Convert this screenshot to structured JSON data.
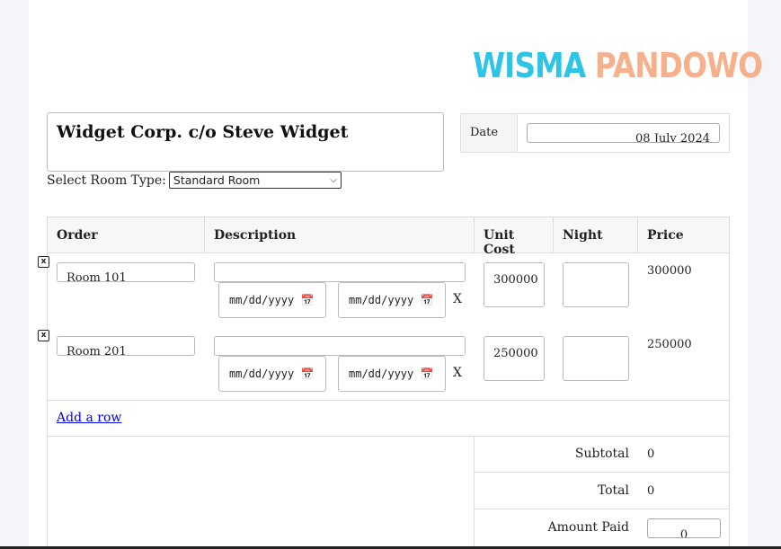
{
  "logo": {
    "word1": "WISMA",
    "word2": "PANDOWO",
    "color1": "#2ec4e6",
    "color2": "#f6b08c"
  },
  "customer": "Widget Corp. c/o Steve Widget",
  "date": {
    "label": "Date",
    "value": "08 July 2024"
  },
  "room_type": {
    "label": "Select Room Type:",
    "selected": "Standard Room"
  },
  "table": {
    "headers": {
      "order": "Order",
      "description": "Description",
      "unit_cost": "Unit Cost",
      "night": "Night",
      "price": "Price"
    },
    "rows": [
      {
        "delete": "x",
        "order": "Room 101",
        "description": "",
        "date_from": "mm/dd/yyyy",
        "date_to": "mm/dd/yyyy",
        "x": "X",
        "unit_cost": "300000",
        "night": "",
        "price": "300000"
      },
      {
        "delete": "x",
        "order": "Room 201",
        "description": "",
        "date_from": "mm/dd/yyyy",
        "date_to": "mm/dd/yyyy",
        "x": "X",
        "unit_cost": "250000",
        "night": "",
        "price": "250000"
      }
    ]
  },
  "add_row": "Add a row",
  "totals": {
    "subtotal_label": "Subtotal",
    "subtotal": "0",
    "total_label": "Total",
    "total": "0",
    "paid_label": "Amount Paid",
    "paid": "0"
  }
}
